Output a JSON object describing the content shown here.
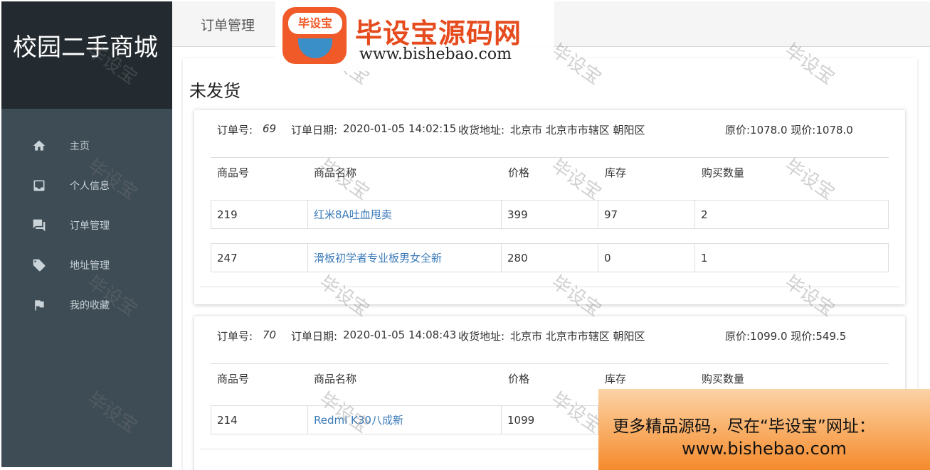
{
  "app": {
    "title": "校园二手商城"
  },
  "sidebar": {
    "items": [
      {
        "label": "主页",
        "icon": "home-icon"
      },
      {
        "label": "个人信息",
        "icon": "inbox-icon"
      },
      {
        "label": "订单管理",
        "icon": "chat-icon"
      },
      {
        "label": "地址管理",
        "icon": "tag-icon"
      },
      {
        "label": "我的收藏",
        "icon": "flag-icon"
      }
    ]
  },
  "topbar": {
    "tab_label": "订单管理"
  },
  "main": {
    "section_title": "未发货",
    "columns": [
      "商品号",
      "商品名称",
      "价格",
      "库存",
      "购买数量"
    ],
    "orders": [
      {
        "order_no_label": "订单号:",
        "order_no": "69",
        "date_label": "订单日期:",
        "date": "2020-01-05 14:02:15",
        "address_label": "收货地址:",
        "address": "北京市 北京市市辖区 朝阳区",
        "price_text": "原价:1078.0 现价:1078.0",
        "items": [
          {
            "id": "219",
            "name": "红米8A吐血甩卖",
            "price": "399",
            "stock": "97",
            "qty": "2"
          },
          {
            "id": "247",
            "name": "滑板初学者专业板男女全新",
            "price": "280",
            "stock": "0",
            "qty": "1"
          }
        ]
      },
      {
        "order_no_label": "订单号:",
        "order_no": "70",
        "date_label": "订单日期:",
        "date": "2020-01-05 14:08:43",
        "address_label": "收货地址:",
        "address": "北京市 北京市市辖区 朝阳区",
        "price_text": "原价:1099.0 现价:549.5",
        "items": [
          {
            "id": "214",
            "name": "Redmi K30八成新",
            "price": "1099",
            "stock": "",
            "qty": ""
          }
        ]
      }
    ]
  },
  "overlay": {
    "watermark_text": "毕设宝",
    "logo_badge": "毕设宝",
    "logo_title": "毕设宝源码网",
    "logo_url": "www.bishebao.com",
    "promo_line1": "更多精品源码，尽在“毕设宝”网址：",
    "promo_line2": "www.bishebao.com"
  },
  "colors": {
    "sidebar_bg": "#3e4c55",
    "brand_bg": "#232b30",
    "link": "#3a7ab8",
    "logo_accent": "#e64b1e"
  }
}
